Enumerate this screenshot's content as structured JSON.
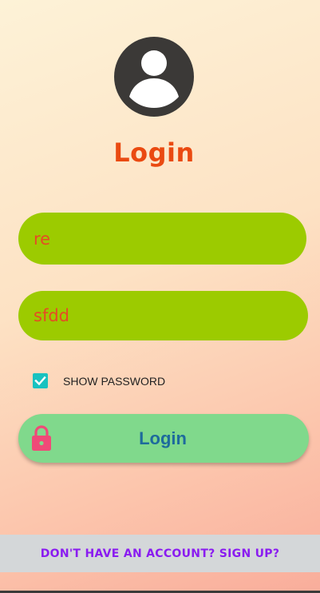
{
  "header": {
    "avatar_icon": "account-circle-icon",
    "title": "Login"
  },
  "form": {
    "username_value": "re",
    "password_value": "sfdd",
    "show_password_label": "SHOW PASSWORD",
    "show_password_checked": true,
    "login_button_label": "Login",
    "login_button_icon": "lock-icon"
  },
  "footer": {
    "signup_link": "DON'T HAVE AN ACCOUNT? SIGN UP?"
  },
  "colors": {
    "title": "#ea4a11",
    "field_bg": "#9ccb00",
    "field_text": "#e64b24",
    "checkbox": "#18c2c0",
    "button_bg": "#80d98c",
    "button_text": "#1e6b9c",
    "lock_icon": "#f04a78",
    "signup_text": "#8a1cf0",
    "signup_bg": "#d4d7d9"
  }
}
